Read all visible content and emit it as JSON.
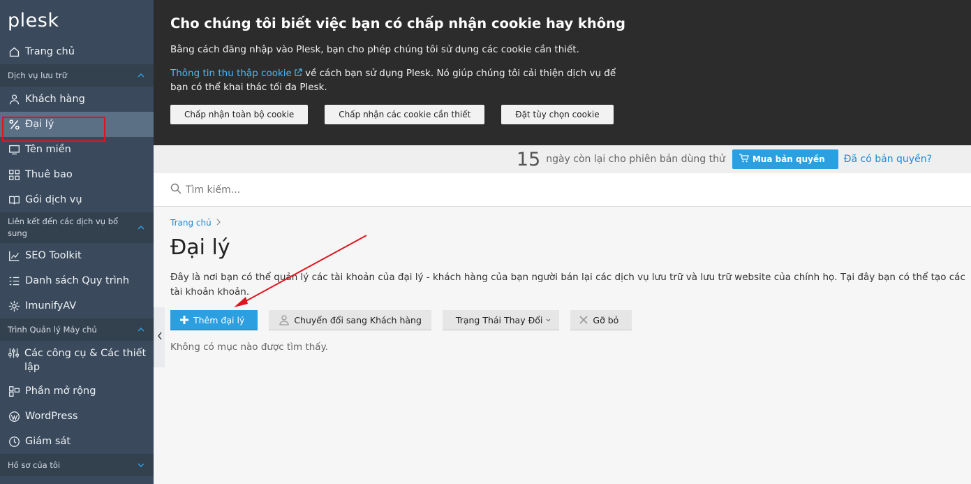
{
  "sidebar": {
    "logo": "plesk",
    "home": "Trang chủ",
    "sections": {
      "hosting": "Dịch vụ lưu trữ",
      "links": "Liên kết đến các dịch vụ bổ sung",
      "server": "Trình Quản lý Máy chủ",
      "profile": "Hồ sơ của tôi"
    },
    "items": [
      {
        "label": "Khách hàng",
        "icon": "user-icon"
      },
      {
        "label": "Đại lý",
        "icon": "percent-icon"
      },
      {
        "label": "Tên miền",
        "icon": "monitor-icon"
      },
      {
        "label": "Thuê bao",
        "icon": "grid-icon"
      },
      {
        "label": "Gói dịch vụ",
        "icon": "book-icon"
      },
      {
        "label": "SEO Toolkit",
        "icon": "chart-icon"
      },
      {
        "label": "Danh sách Quy trình",
        "icon": "list-icon"
      },
      {
        "label": "ImunifyAV",
        "icon": "gear-icon"
      },
      {
        "label": "Các công cụ & Các thiết lập",
        "icon": "sliders-icon"
      },
      {
        "label": "Phần mở rộng",
        "icon": "extensions-icon"
      },
      {
        "label": "WordPress",
        "icon": "wordpress-icon"
      },
      {
        "label": "Giám sát",
        "icon": "monitoring-icon"
      }
    ]
  },
  "cookie": {
    "title": "Cho chúng tôi biết việc bạn có chấp nhận cookie hay không",
    "line1": "Bằng cách đăng nhập vào Plesk, bạn cho phép chúng tôi sử dụng các cookie cần thiết.",
    "link": "Thông tin thu thập cookie",
    "line2": " về cách bạn sử dụng Plesk. Nó giúp chúng tôi cải thiện dịch vụ để bạn có thể khai thác tối đa Plesk.",
    "accept_all": "Chấp nhận toàn bộ cookie",
    "accept_required": "Chấp nhận các cookie cần thiết",
    "customize": "Đặt tùy chọn cookie"
  },
  "trial": {
    "days": "15",
    "text": "ngày còn lại cho phiên bản dùng thử",
    "buy": "Mua bản quyền",
    "have": "Đã có bản quyền?"
  },
  "search": {
    "placeholder": "Tìm kiếm..."
  },
  "main": {
    "breadcrumb": "Trang chủ",
    "title": "Đại lý",
    "description": "Đây là nơi bạn có thể quản lý các tài khoản của đại lý - khách hàng của bạn người bán lại các dịch vụ lưu trữ và lưu trữ website của chính họ. Tại đây bạn có thể tạo các tài khoản khoản.",
    "toolbar": {
      "add": "Thêm đại lý",
      "convert": "Chuyển đổi sang Khách hàng",
      "status": "Trạng Thái Thay Đổi",
      "remove": "Gỡ bỏ"
    },
    "empty": "Không có mục nào được tìm thấy."
  },
  "colors": {
    "accent": "#2b9fe0",
    "sidebar": "#3a4a5c",
    "highlight": "#e0141e"
  }
}
